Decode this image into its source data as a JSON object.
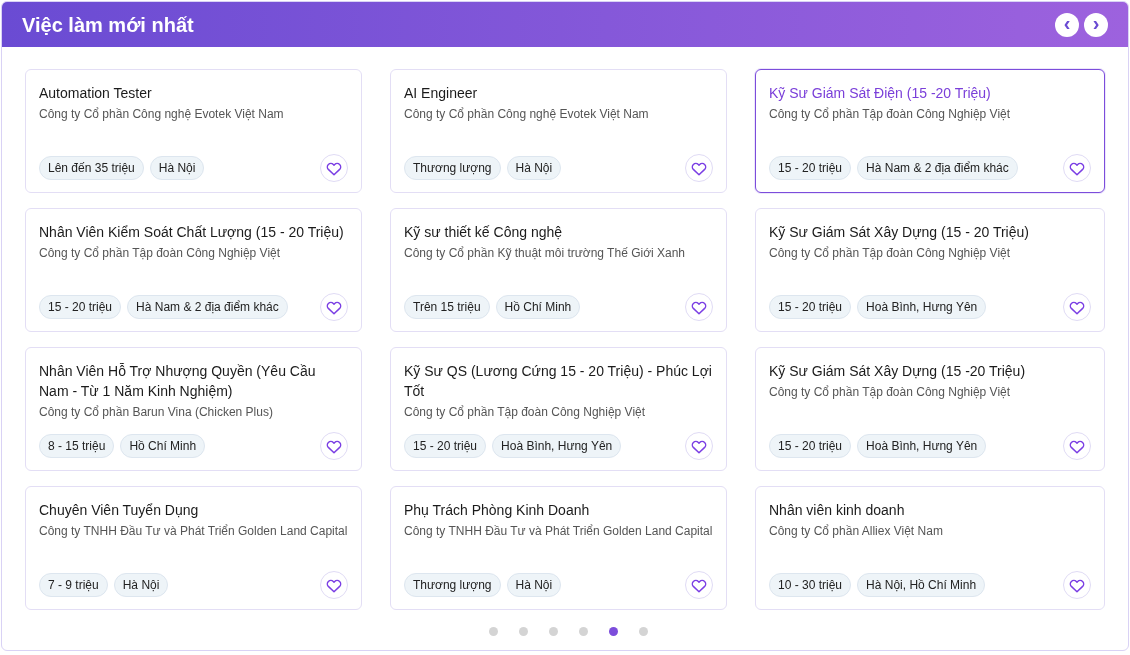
{
  "header": {
    "title": "Việc làm mới nhất",
    "prev_button": "‹",
    "next_button": "›"
  },
  "jobs": [
    {
      "title": "Automation Tester",
      "company": "Công ty Cổ phần Công nghệ Evotek Việt Nam",
      "tags": [
        "Lên đến 35 triệu",
        "Hà Nội"
      ],
      "selected": false
    },
    {
      "title": "AI Engineer",
      "company": "Công ty Cổ phần Công nghệ Evotek Việt Nam",
      "tags": [
        "Thương lượng",
        "Hà Nội"
      ],
      "selected": false
    },
    {
      "title": "Kỹ Sư Giám Sát Điện (15 -20 Triệu)",
      "company": "Công ty Cổ phần Tập đoàn Công Nghiệp Việt",
      "tags": [
        "15 - 20 triệu",
        "Hà Nam & 2 địa điểm khác"
      ],
      "selected": true
    },
    {
      "title": "Nhân Viên Kiểm Soát Chất Lượng (15 - 20 Triệu)",
      "company": "Công ty Cổ phần Tập đoàn Công Nghiệp Việt",
      "tags": [
        "15 - 20 triệu",
        "Hà Nam & 2 địa điểm khác"
      ],
      "selected": false
    },
    {
      "title": "Kỹ sư thiết kế Công nghệ",
      "company": "Công ty Cổ phần Kỹ thuật môi trường Thế Giới Xanh",
      "tags": [
        "Trên 15 triệu",
        "Hồ Chí Minh"
      ],
      "selected": false
    },
    {
      "title": "Kỹ Sư Giám Sát Xây Dựng (15 - 20 Triệu)",
      "company": "Công ty Cổ phần Tập đoàn Công Nghiệp Việt",
      "tags": [
        "15 - 20 triệu",
        "Hoà Bình, Hưng Yên"
      ],
      "selected": false
    },
    {
      "title": "Nhân Viên Hỗ Trợ Nhượng Quyền (Yêu Cầu Nam - Từ 1 Năm Kinh Nghiệm)",
      "company": "Công ty Cổ phần Barun Vina (Chicken Plus)",
      "tags": [
        "8 - 15 triệu",
        "Hồ Chí Minh"
      ],
      "selected": false
    },
    {
      "title": "Kỹ Sư QS (Lương Cứng 15 - 20 Triệu) - Phúc Lợi Tốt",
      "company": "Công ty Cổ phần Tập đoàn Công Nghiệp Việt",
      "tags": [
        "15 - 20 triệu",
        "Hoà Bình, Hưng Yên"
      ],
      "selected": false
    },
    {
      "title": "Kỹ Sư Giám Sát Xây Dựng (15 -20 Triệu)",
      "company": "Công ty Cổ phần Tập đoàn Công Nghiệp Việt",
      "tags": [
        "15 - 20 triệu",
        "Hoà Bình, Hưng Yên"
      ],
      "selected": false
    },
    {
      "title": "Chuyên Viên Tuyển Dụng",
      "company": "Công ty TNHH Đầu Tư và Phát Triển Golden Land Capital",
      "tags": [
        "7 - 9 triệu",
        "Hà Nội"
      ],
      "selected": false
    },
    {
      "title": "Phụ Trách Phòng Kinh Doanh",
      "company": "Công ty TNHH Đầu Tư và Phát Triển Golden Land Capital",
      "tags": [
        "Thương lượng",
        "Hà Nội"
      ],
      "selected": false
    },
    {
      "title": "Nhân viên kinh doanh",
      "company": "Công ty Cổ phần Alliex Việt Nam",
      "tags": [
        "10 - 30 triệu",
        "Hà Nội, Hồ Chí Minh"
      ],
      "selected": false
    }
  ],
  "pagination": [
    {
      "selected": false
    },
    {
      "selected": false
    },
    {
      "selected": false
    },
    {
      "selected": false
    },
    {
      "selected": true
    },
    {
      "selected": false
    }
  ]
}
